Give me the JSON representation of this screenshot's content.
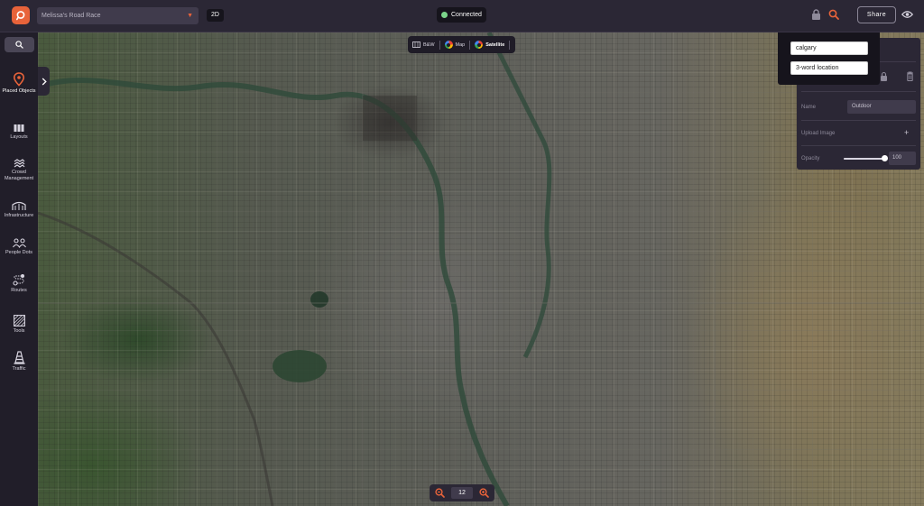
{
  "topbar": {
    "project_name": "Melissa's Road Race",
    "view_mode": "2D",
    "connection_status": "Connected",
    "share_label": "Share",
    "accent": "#e8633a"
  },
  "sidebar": {
    "items": [
      {
        "label": "Placed Objects",
        "icon": "map-pin-icon"
      },
      {
        "label": "Layouts",
        "icon": "layouts-icon"
      },
      {
        "label": "Crowd Management",
        "icon": "crowd-icon"
      },
      {
        "label": "Infrastructure",
        "icon": "infrastructure-icon"
      },
      {
        "label": "People Dots",
        "icon": "people-icon"
      },
      {
        "label": "Routes",
        "icon": "routes-icon"
      },
      {
        "label": "Tools",
        "icon": "tools-icon"
      },
      {
        "label": "Traffic",
        "icon": "traffic-cone-icon"
      }
    ]
  },
  "map_types": {
    "options": [
      "B&W",
      "Map",
      "Satellite"
    ],
    "selected": "Satellite"
  },
  "zoom": {
    "level": "12"
  },
  "search": {
    "location_value": "calgary",
    "word_location_placeholder": "3-word location"
  },
  "properties_panel": {
    "name_label": "Name",
    "name_value": "Outdoor",
    "upload_label": "Upload Image",
    "opacity_label": "Opacity",
    "opacity_value": "100"
  }
}
